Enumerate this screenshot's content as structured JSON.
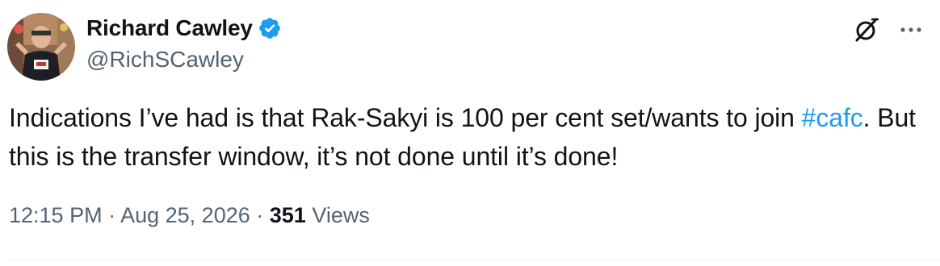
{
  "author": {
    "display_name": "Richard Cawley",
    "handle": "@RichSCawley",
    "verified_icon": "verified-badge-icon",
    "verified_color": "#1d9bf0"
  },
  "actions": {
    "grok_icon": "grok-icon",
    "more_icon": "more-options-icon"
  },
  "tweet": {
    "text_before": "Indications I’ve had is that Rak-Sakyi is 100 per cent set/wants to join ",
    "hashtag": "#cafc",
    "text_after": ". But this is the transfer window, it’s not done until it’s done!"
  },
  "meta": {
    "time": "12:15 PM",
    "separator": " · ",
    "date": "Aug 25, 2026",
    "views_count": "351",
    "views_label": " Views"
  },
  "colors": {
    "text": "#0f1419",
    "secondary": "#536471",
    "link": "#1d9bf0"
  }
}
